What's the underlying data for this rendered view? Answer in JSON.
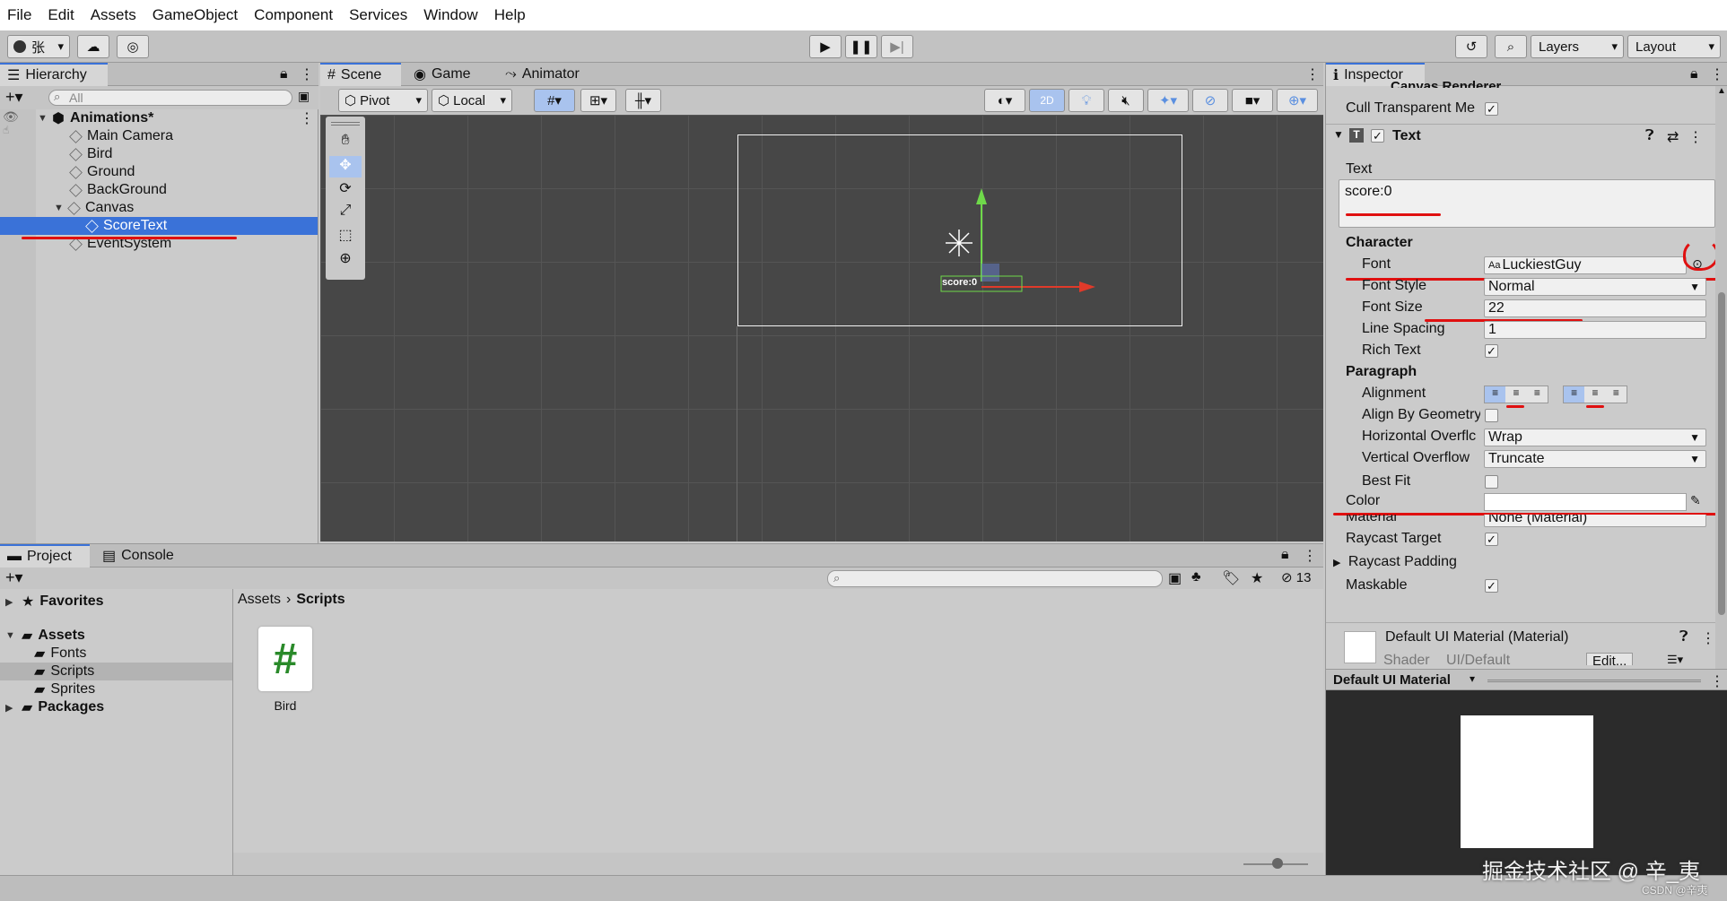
{
  "menu": [
    "File",
    "Edit",
    "Assets",
    "GameObject",
    "Component",
    "Services",
    "Window",
    "Help"
  ],
  "toolbar": {
    "account_label": "张",
    "layers_label": "Layers",
    "layout_label": "Layout"
  },
  "hierarchy": {
    "tab_label": "Hierarchy",
    "search_placeholder": "All",
    "scene_name": "Animations*",
    "items": [
      {
        "label": "Main Camera"
      },
      {
        "label": "Bird"
      },
      {
        "label": "Ground"
      },
      {
        "label": "BackGround"
      },
      {
        "label": "Canvas"
      },
      {
        "label": "ScoreText"
      },
      {
        "label": "EventSystem"
      }
    ]
  },
  "scene_view": {
    "tabs": [
      "Scene",
      "Game",
      "Animator"
    ],
    "pivot_label": "Pivot",
    "local_label": "Local",
    "mode_2d_label": "2D",
    "score_label": "score:0"
  },
  "project": {
    "tabs": [
      "Project",
      "Console"
    ],
    "favorites_label": "Favorites",
    "assets_label": "Assets",
    "asset_folders": [
      "Fonts",
      "Scripts",
      "Sprites"
    ],
    "packages_label": "Packages",
    "breadcrumb": [
      "Assets",
      "Scripts"
    ],
    "hidden_count": "13",
    "files": [
      {
        "name": "Bird",
        "icon": "#"
      }
    ]
  },
  "inspector": {
    "tab_label": "Inspector",
    "cut_header": "Canvas Renderer",
    "cull_label": "Cull Transparent Me",
    "component_title": "Text",
    "text_label": "Text",
    "text_value": "score:0",
    "character_label": "Character",
    "font_label": "Font",
    "font_value": "LuckiestGuy",
    "font_style_label": "Font Style",
    "font_style_value": "Normal",
    "font_size_label": "Font Size",
    "font_size_value": "22",
    "line_spacing_label": "Line Spacing",
    "line_spacing_value": "1",
    "rich_text_label": "Rich Text",
    "paragraph_label": "Paragraph",
    "alignment_label": "Alignment",
    "align_geometry_label": "Align By Geometry",
    "h_overflow_label": "Horizontal Overflc",
    "h_overflow_value": "Wrap",
    "v_overflow_label": "Vertical Overflow",
    "v_overflow_value": "Truncate",
    "best_fit_label": "Best Fit",
    "color_label": "Color",
    "material_label": "Material",
    "material_value": "None (Material)",
    "raycast_target_label": "Raycast Target",
    "raycast_padding_label": "Raycast Padding",
    "maskable_label": "Maskable",
    "default_material_title": "Default UI Material (Material)",
    "shader_label": "Shader",
    "shader_value": "UI/Default",
    "edit_label": "Edit...",
    "preview_title": "Default UI Material"
  },
  "watermark": "掘金技术社区 @ 辛_夷",
  "watermark_small": "CSDN @辛夷",
  "colors": {
    "selection": "#3a72d8",
    "annotation_red": "#e01010",
    "scene_bg": "#474747",
    "gizmo_green": "#6fd94a",
    "gizmo_red": "#e03a2a"
  }
}
